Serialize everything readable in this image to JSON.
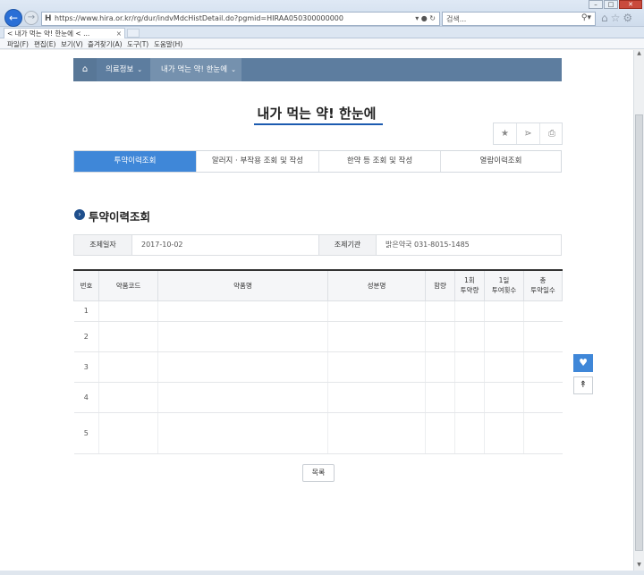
{
  "browser": {
    "url": "https://www.hira.or.kr/rg/dur/indvMdcHistDetail.do?pgmid=HIRAA050300000000",
    "search_placeholder": "검색...",
    "tab_title": "< 내가 먹는 약! 한눈에 < ...",
    "menu": [
      "파일(F)",
      "편집(E)",
      "보기(V)",
      "즐겨찾기(A)",
      "도구(T)",
      "도움말(H)"
    ]
  },
  "site_nav": {
    "home_icon": "home-icon",
    "items": [
      {
        "label": "의료정보"
      },
      {
        "label": "내가 먹는 약! 한눈에"
      }
    ]
  },
  "page": {
    "title": "내가 먹는 약! 한눈에",
    "tabs": [
      {
        "label": "투약이력조회",
        "active": true
      },
      {
        "label": "알러지 · 부작용 조회 및 작성",
        "active": false
      },
      {
        "label": "한약 등 조회 및 작성",
        "active": false
      },
      {
        "label": "열람이력조회",
        "active": false
      }
    ],
    "section_title": "투약이력조회",
    "info": {
      "date_label": "조제일자",
      "date_value": "2017-10-02",
      "org_label": "조제기관",
      "org_value": "밝은약국 031-8015-1485"
    },
    "table": {
      "headers": [
        "번호",
        "약품코드",
        "약품명",
        "성분명",
        "함량",
        "1회\n투약량",
        "1일\n투여횟수",
        "총\n투약일수"
      ],
      "rows": [
        {
          "no": "1"
        },
        {
          "no": "2"
        },
        {
          "no": "3"
        },
        {
          "no": "4"
        },
        {
          "no": "5"
        }
      ]
    },
    "list_button": "목록"
  },
  "accent_color": "#3f87d8",
  "nav_color": "#5d7d9f"
}
